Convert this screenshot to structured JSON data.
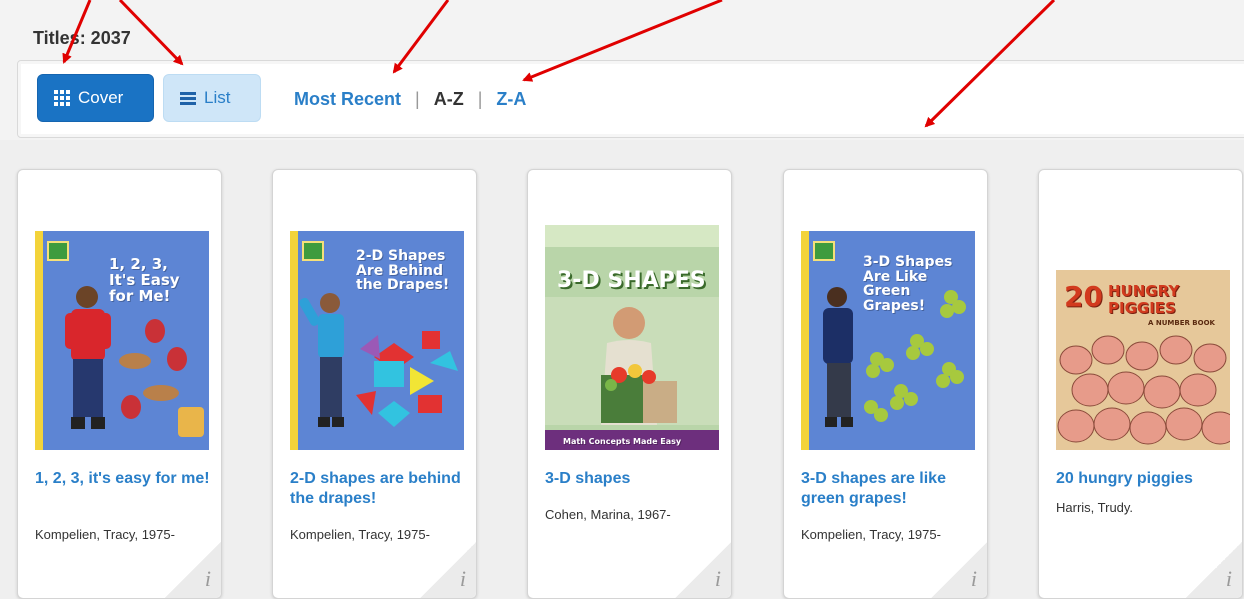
{
  "header": {
    "titles_label": "Titles: 2037"
  },
  "toolbar": {
    "cover_label": "Cover",
    "list_label": "List",
    "sort_most_recent": "Most Recent",
    "sort_az": "A-Z",
    "sort_za": "Z-A",
    "separator": "|"
  },
  "books": [
    {
      "title": "1, 2, 3, it's easy for me!",
      "author": "Kompelien, Tracy, 1975-",
      "cover_lines": [
        "1, 2, 3,",
        "It's Easy",
        "for Me!"
      ]
    },
    {
      "title": "2-D shapes are behind the drapes!",
      "author": "Kompelien, Tracy, 1975-",
      "cover_lines": [
        "2-D Shapes",
        "Are Behind",
        "the Drapes!"
      ]
    },
    {
      "title": "3-D shapes",
      "author": "Cohen, Marina, 1967-",
      "cover_lines": [
        "3-D SHAPES"
      ],
      "cover_footer": "Math Concepts Made Easy"
    },
    {
      "title": "3-D shapes are like green grapes!",
      "author": "Kompelien, Tracy, 1975-",
      "cover_lines": [
        "3-D Shapes",
        "Are Like",
        "Green",
        "Grapes!"
      ]
    },
    {
      "title": "20 hungry piggies",
      "author": "Harris, Trudy.",
      "cover_lines": [
        "20",
        "HUNGRY",
        "PIGGIES"
      ],
      "cover_subtitle": "A NUMBER BOOK"
    }
  ],
  "icons": {
    "cover_view": "grid-icon",
    "list_view": "list-icon",
    "info": "info-icon"
  },
  "colors": {
    "accent": "#1a73c4",
    "link": "#2a7fc8",
    "annotation_arrow": "#e00000"
  }
}
